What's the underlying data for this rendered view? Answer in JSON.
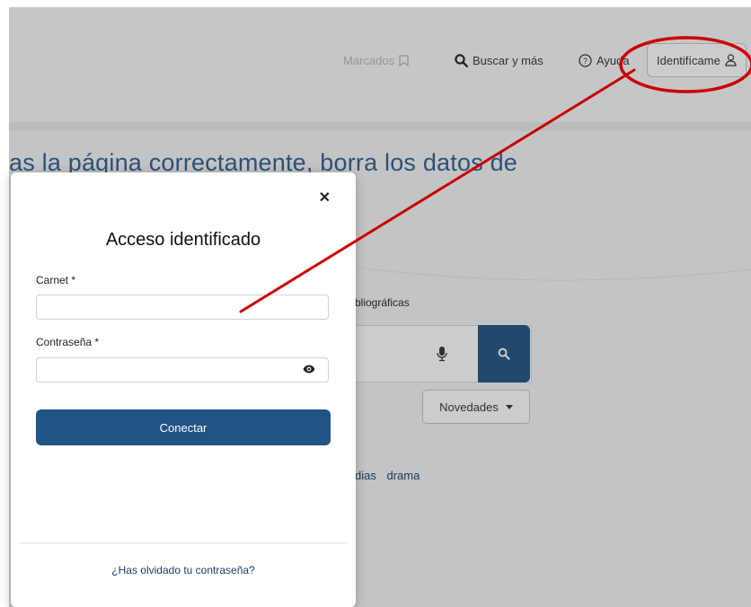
{
  "header": {
    "bookmarks_label": "Marcados",
    "search_label": "Buscar y más",
    "help_label": "Ayuda",
    "login_label": "Identifícame"
  },
  "hero": {
    "text": "as la página correctamente, borra los datos de"
  },
  "search": {
    "filter_label": "bliográficas",
    "sort_label": "Novedades"
  },
  "tags": [
    "dias",
    "drama"
  ],
  "modal": {
    "title": "Acceso identificado",
    "carnet_label": "Carnet *",
    "password_label": "Contraseña *",
    "connect_label": "Conectar",
    "forgot_label": "¿Has olvidado tu contraseña?"
  },
  "colors": {
    "primary": "#1f5484",
    "link": "#1a3e6b",
    "annotation": "#cc0000"
  }
}
